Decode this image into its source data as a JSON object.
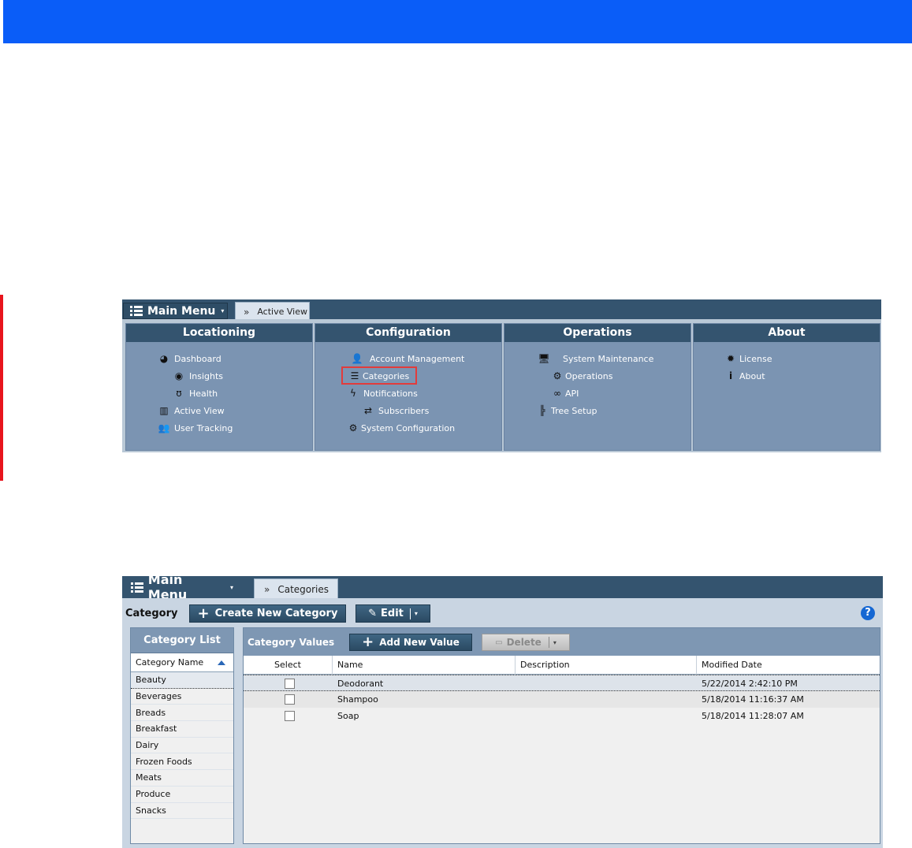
{
  "screen1": {
    "main_menu_label": "Main Menu",
    "tab_label": "Active View",
    "columns": [
      {
        "title": "Locationing",
        "items": [
          {
            "label": "Dashboard",
            "icon": "dashboard-icon"
          },
          {
            "label": "Insights",
            "icon": "eye-icon"
          },
          {
            "label": "Health",
            "icon": "stethoscope-icon"
          },
          {
            "label": "Active View",
            "icon": "bar-chart-icon"
          },
          {
            "label": "User Tracking",
            "icon": "users-icon"
          }
        ]
      },
      {
        "title": "Configuration",
        "items": [
          {
            "label": "Account Management",
            "icon": "user-lock-icon"
          },
          {
            "label": "Categories",
            "icon": "list-icon"
          },
          {
            "label": "Notifications",
            "icon": "bolt-icon"
          },
          {
            "label": "Subscribers",
            "icon": "exchange-icon"
          },
          {
            "label": "System Configuration",
            "icon": "cogs-icon"
          }
        ]
      },
      {
        "title": "Operations",
        "items": [
          {
            "label": "System Maintenance",
            "icon": "monitor-gear-icon"
          },
          {
            "label": "Operations",
            "icon": "cogs-icon"
          },
          {
            "label": "API",
            "icon": "link-icon"
          },
          {
            "label": "Tree Setup",
            "icon": "sitemap-icon"
          }
        ]
      },
      {
        "title": "About",
        "items": [
          {
            "label": "License",
            "icon": "certificate-icon"
          },
          {
            "label": "About",
            "icon": "info-icon"
          }
        ]
      }
    ]
  },
  "screen2": {
    "main_menu_label": "Main Menu",
    "tab_label": "Categories",
    "category_label": "Category",
    "create_button": "Create New Category",
    "edit_button": "Edit",
    "help_label": "?",
    "category_list": {
      "title": "Category List",
      "column": "Category Name",
      "items": [
        "Beauty",
        "Beverages",
        "Breads",
        "Breakfast",
        "Dairy",
        "Frozen Foods",
        "Meats",
        "Produce",
        "Snacks"
      ]
    },
    "category_values": {
      "title": "Category Values",
      "add_button": "Add New Value",
      "delete_button": "Delete",
      "columns": [
        "Select",
        "Name",
        "Description",
        "Modified Date"
      ],
      "rows": [
        {
          "name": "Deodorant",
          "description": "",
          "modified": "5/22/2014 2:42:10 PM"
        },
        {
          "name": "Shampoo",
          "description": "",
          "modified": "5/18/2014 11:16:37 AM"
        },
        {
          "name": "Soap",
          "description": "",
          "modified": "5/18/2014 11:28:07 AM"
        }
      ]
    }
  },
  "colors": {
    "banner": "#0a5df8",
    "header_dark": "#34546f",
    "menu_column": "#7b94b2",
    "highlight": "#e23b3b"
  }
}
